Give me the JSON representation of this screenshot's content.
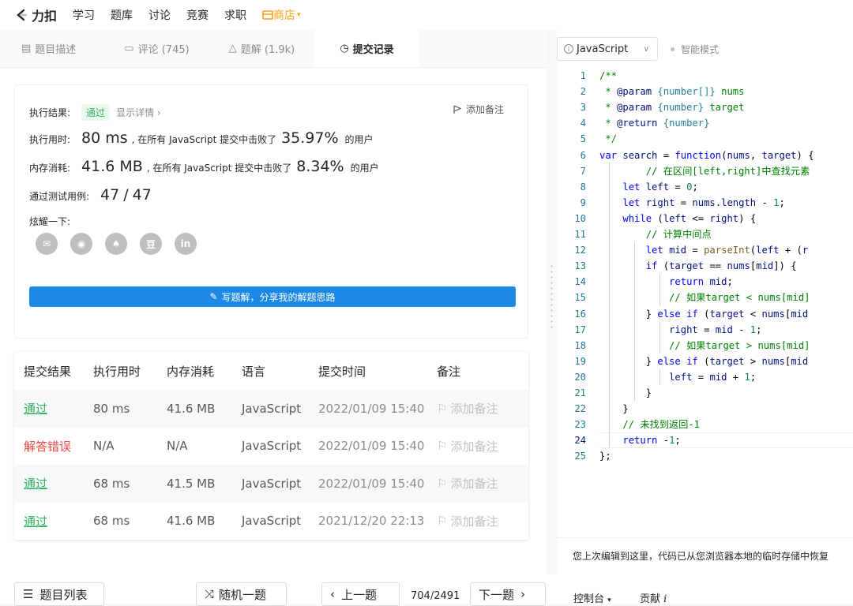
{
  "topnav": {
    "brand": "力扣",
    "links": [
      "学习",
      "题库",
      "讨论",
      "竞赛",
      "求职"
    ],
    "store": "商店",
    "brand_color": "#262626",
    "store_color": "#ffa116"
  },
  "tabs": [
    {
      "label": "题目描述",
      "icon": "description-icon"
    },
    {
      "label": "评论 (745)",
      "icon": "comment-icon"
    },
    {
      "label": "题解 (1.9k)",
      "icon": "flask-icon"
    },
    {
      "label": "提交记录",
      "icon": "clock-icon"
    }
  ],
  "result": {
    "status_label": "执行结果:",
    "status": "通过",
    "details_link": "显示详情",
    "add_note": "添加备注",
    "runtime_label": "执行用时:",
    "runtime_value": "80 ms",
    "runtime_beat_text": ", 在所有 JavaScript 提交中击败了",
    "runtime_percent": "35.97%",
    "users_text": "的用户",
    "memory_label": "内存消耗:",
    "memory_value": "41.6 MB",
    "memory_beat_text": ", 在所有 JavaScript 提交中击败了",
    "memory_percent": "8.34%",
    "cases_label": "通过测试用例:",
    "cases_passed": "47",
    "cases_sep": "/",
    "cases_total": "47",
    "share_label": "炫耀一下:",
    "write_solution": "写题解，分享我的解题思路"
  },
  "submissions": {
    "headers": [
      "提交结果",
      "执行用时",
      "内存消耗",
      "语言",
      "提交时间",
      "备注"
    ],
    "rows": [
      {
        "status": "通过",
        "runtime": "80 ms",
        "memory": "41.6 MB",
        "lang": "JavaScript",
        "time": "2022/01/09 15:40",
        "note": "添加备注",
        "ok": true
      },
      {
        "status": "解答错误",
        "runtime": "N/A",
        "memory": "N/A",
        "lang": "JavaScript",
        "time": "2022/01/09 15:40",
        "note": "添加备注",
        "ok": false
      },
      {
        "status": "通过",
        "runtime": "68 ms",
        "memory": "41.5 MB",
        "lang": "JavaScript",
        "time": "2022/01/09 15:40",
        "note": "添加备注",
        "ok": true
      },
      {
        "status": "通过",
        "runtime": "68 ms",
        "memory": "41.6 MB",
        "lang": "JavaScript",
        "time": "2021/12/20 22:13",
        "note": "添加备注",
        "ok": true
      }
    ]
  },
  "bottom": {
    "problem_list": "题目列表",
    "random": "随机一题",
    "prev": "上一题",
    "pager": "704/2491",
    "next": "下一题",
    "console": "控制台",
    "contribute": "贡献"
  },
  "editor": {
    "language": "JavaScript",
    "smart_mode": "智能模式",
    "restore_message": "您上次编辑到这里，代码已从您浏览器本地的临时存储中恢复",
    "lines": [
      "/**",
      " * @param {number[]} nums",
      " * @param {number} target",
      " * @return {number}",
      " */",
      "var search = function(nums, target) {",
      "        // 在区间[left,right]中查找元素",
      "    let left = 0;",
      "    let right = nums.length - 1;",
      "    while (left <= right) {",
      "        // 计算中间点",
      "        let mid = parseInt(left + (r",
      "        if (target == nums[mid]) {",
      "            return mid;",
      "            // 如果target < nums[mid]",
      "        } else if (target < nums[mid",
      "            right = mid - 1;",
      "            // 如果target > nums[mid]",
      "        } else if (target > nums[mid",
      "            left = mid + 1;",
      "        }",
      "    }",
      "    // 未找到返回-1",
      "    return -1;",
      "};"
    ]
  }
}
